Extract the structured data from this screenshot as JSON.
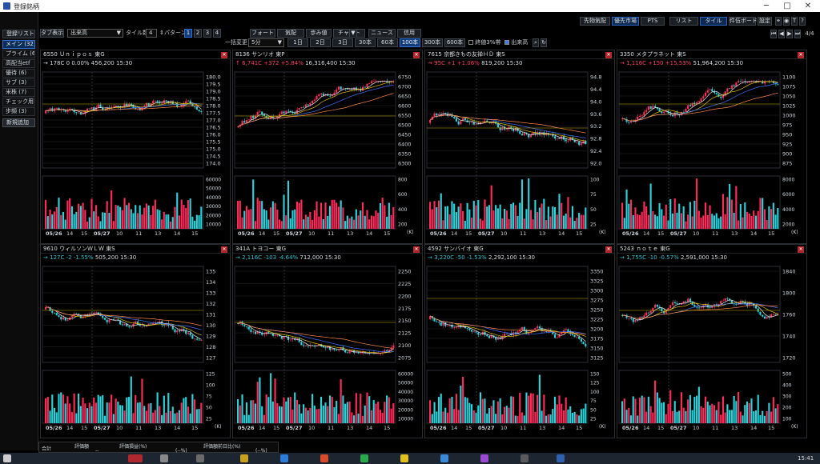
{
  "window": {
    "title": "登録銘柄",
    "min": "─",
    "max": "□",
    "close": "✕"
  },
  "sidebar": {
    "header": "登録リスト",
    "items": [
      "メイン (32)",
      "プライム (6)",
      "高配当etf",
      "優待 (6)",
      "サブ (3)",
      "米株 (7)",
      "チェック用 (",
      "步頻 (3)"
    ],
    "selected": 0,
    "add": "新規追加"
  },
  "toolbar": {
    "tab_display_label": "タブ表示",
    "tab_select": "出来高",
    "tile_count_label": "タイル数",
    "tile_count": "4",
    "pattern_label": "パターン",
    "patterns": [
      "1",
      "2",
      "3",
      "4"
    ],
    "pattern_selected": 0,
    "top_right": [
      "先物気配",
      "優先市場",
      "PTS",
      "リスト",
      "タイル",
      "件伍ボード",
      "設定"
    ],
    "batch_label": "一括変更",
    "batch_buttons": [
      "フォート",
      "気配",
      "歩み値",
      "チャート",
      "ニュース",
      "信用"
    ],
    "interval": "5分",
    "ranges": [
      "1日",
      "2日",
      "3日",
      "30本",
      "60本",
      "100本",
      "300本",
      "600本"
    ],
    "range_selected": 5,
    "cb_pbr": "終値3%帯",
    "cb_volume": "出来高",
    "page": "4/4"
  },
  "colors": {
    "up": "#ff2a5a",
    "down": "#29d3dc",
    "ma1": "#e6e6e6",
    "ma2": "#e0c000",
    "ma3": "#3a73ff",
    "ma4": "#ff8844",
    "bg": "#000000"
  },
  "tiles": [
    {
      "code": "6550",
      "name": "Ｕｎｉｐｏｓ",
      "market": "東G",
      "arrow": "→",
      "price": "178",
      "mark": "C",
      "change": "0",
      "pct": "0.00%",
      "volume": "456,200",
      "time": "15:30",
      "dir": "wh",
      "yticks": [
        "180.0",
        "179.5",
        "179.0",
        "178.5",
        "178.0",
        "177.5",
        "177.0",
        "176.5",
        "176.0",
        "175.5",
        "175.0",
        "174.5",
        "174.0"
      ],
      "vticks": [
        "60000",
        "50000",
        "40000",
        "30000",
        "20000",
        "10000"
      ],
      "xlabels": [
        "05/26",
        "14",
        "15",
        "05/27",
        "10",
        "11",
        "13",
        "14",
        "15"
      ],
      "vunit": ""
    },
    {
      "code": "8136",
      "name": "サンリオ",
      "market": "東P",
      "arrow": "↑",
      "price": "6,741",
      "mark": "C",
      "change": "+372",
      "pct": "+5.84%",
      "volume": "16,316,400",
      "time": "15:30",
      "dir": "up",
      "yticks": [
        "6750",
        "6700",
        "6650",
        "6600",
        "6550",
        "6500",
        "6450",
        "6400",
        "6350",
        "6300"
      ],
      "vticks": [
        "800",
        "600",
        "400",
        "200"
      ],
      "xlabels": [
        "05/26",
        "14",
        "15",
        "05/27",
        "10",
        "11",
        "13",
        "14",
        "15"
      ],
      "vunit": "(K)"
    },
    {
      "code": "7615",
      "name": "京都きもの友禅ＨＤ",
      "market": "東S",
      "arrow": "→",
      "price": "95",
      "mark": "C",
      "change": "+1",
      "pct": "+1.06%",
      "volume": "819,200",
      "time": "15:30",
      "dir": "up",
      "yticks": [
        "94.8",
        "94.4",
        "94.0",
        "93.6",
        "93.2",
        "92.8",
        "92.4",
        "92.0"
      ],
      "vticks": [
        "100",
        "75",
        "50",
        "25"
      ],
      "xlabels": [
        "05/26",
        "14",
        "15",
        "05/27",
        "10",
        "11",
        "13",
        "14",
        "15"
      ],
      "vunit": "(K)"
    },
    {
      "code": "3350",
      "name": "メタプラネット",
      "market": "東S",
      "arrow": "→",
      "price": "1,116",
      "mark": "C",
      "change": "+150",
      "pct": "+15.53%",
      "volume": "51,964,200",
      "time": "15:30",
      "dir": "up",
      "yticks": [
        "1100",
        "1075",
        "1050",
        "1025",
        "1000",
        "975",
        "950",
        "925",
        "900",
        "875"
      ],
      "vticks": [
        "8000",
        "6000",
        "4000",
        "2000"
      ],
      "xlabels": [
        "05/26",
        "14",
        "15",
        "05/27",
        "10",
        "11",
        "13",
        "14",
        "15"
      ],
      "vunit": "(K)"
    },
    {
      "code": "9610",
      "name": "ウィルソンＷＬＷ",
      "market": "東S",
      "arrow": "→",
      "price": "127",
      "mark": "C",
      "change": "-2",
      "pct": "-1.55%",
      "volume": "505,200",
      "time": "15:30",
      "dir": "dn",
      "yticks": [
        "135",
        "134",
        "133",
        "132",
        "131",
        "130",
        "129",
        "128",
        "127"
      ],
      "vticks": [
        "125",
        "100",
        "75",
        "50",
        "25"
      ],
      "xlabels": [
        "05/26",
        "14",
        "15",
        "05/27",
        "10",
        "11",
        "13",
        "14",
        "15"
      ],
      "vunit": "(K)"
    },
    {
      "code": "341A",
      "name": "トヨコー",
      "market": "東G",
      "arrow": "→",
      "price": "2,116",
      "mark": "C",
      "change": "-103",
      "pct": "-4.64%",
      "volume": "712,000",
      "time": "15:30",
      "dir": "dn",
      "yticks": [
        "2250",
        "2225",
        "2200",
        "2175",
        "2150",
        "2125",
        "2100",
        "2075"
      ],
      "vticks": [
        "60000",
        "50000",
        "40000",
        "30000",
        "20000",
        "10000"
      ],
      "xlabels": [
        "05/26",
        "14",
        "15",
        "05/27",
        "10",
        "11",
        "13",
        "14",
        "15"
      ],
      "vunit": ""
    },
    {
      "code": "4592",
      "name": "サンバイオ",
      "market": "東G",
      "arrow": "→",
      "price": "3,220",
      "mark": "C",
      "change": "-50",
      "pct": "-1.53%",
      "volume": "2,292,100",
      "time": "15:30",
      "dir": "dn",
      "yticks": [
        "3350",
        "3325",
        "3300",
        "3275",
        "3250",
        "3225",
        "3200",
        "3175",
        "3150",
        "3125"
      ],
      "vticks": [
        "150",
        "125",
        "100",
        "75",
        "50",
        "25"
      ],
      "xlabels": [
        "05/26",
        "14",
        "15",
        "05/27",
        "10",
        "11",
        "13",
        "14",
        "15"
      ],
      "vunit": "(K)"
    },
    {
      "code": "5243",
      "name": "ｎｏｔｅ",
      "market": "東G",
      "arrow": "→",
      "price": "1,755",
      "mark": "C",
      "change": "-10",
      "pct": "-0.57%",
      "volume": "2,591,000",
      "time": "15:30",
      "dir": "dn",
      "yticks": [
        "1840",
        "1800",
        "1760",
        "1740",
        "1720"
      ],
      "vticks": [
        "500",
        "400",
        "300",
        "200",
        "100"
      ],
      "xlabels": [
        "05/26",
        "14",
        "15",
        "05/27",
        "10",
        "11",
        "13",
        "14",
        "15"
      ],
      "vunit": "(K)"
    }
  ],
  "bottom": {
    "label": "合計",
    "cols": [
      "評価額",
      "評価損益(%)",
      "評価額前日比(%)"
    ],
    "vals": [
      "--",
      "(--%)",
      "(--%)"
    ]
  },
  "taskbar": {
    "time": "15:41"
  }
}
